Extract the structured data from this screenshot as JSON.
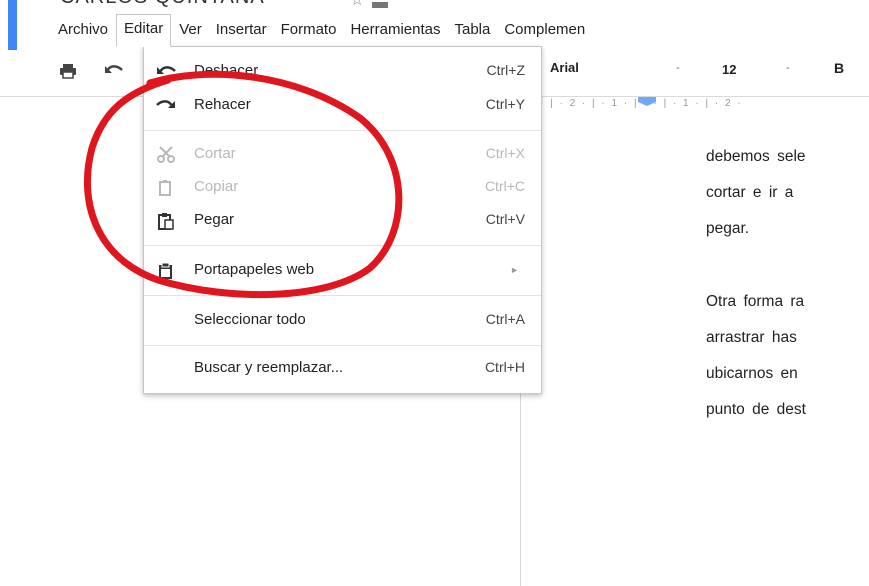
{
  "document": {
    "title": "CARLOS QUINTANA",
    "lines": [
      "debemos sele",
      "cortar e ir a",
      "pegar.",
      "Otra forma ra",
      "arrastrar has",
      "ubicarnos en",
      "punto de dest"
    ]
  },
  "menubar": {
    "items": [
      "Archivo",
      "Editar",
      "Ver",
      "Insertar",
      "Formato",
      "Herramientas",
      "Tabla",
      "Complemen"
    ]
  },
  "toolbar": {
    "font": "Arial",
    "size": "12",
    "bold": "B",
    "ruler_text": "· | · 2 · | · 1 · | ·    · | · 1 · | · 2 ·"
  },
  "edit_menu": {
    "items": [
      {
        "label": "Deshacer",
        "shortcut": "Ctrl+Z",
        "icon": "undo-icon",
        "enabled": true
      },
      {
        "label": "Rehacer",
        "shortcut": "Ctrl+Y",
        "icon": "redo-icon",
        "enabled": true
      },
      {
        "label": "Cortar",
        "shortcut": "Ctrl+X",
        "icon": "scissors-icon",
        "enabled": false
      },
      {
        "label": "Copiar",
        "shortcut": "Ctrl+C",
        "icon": "copy-icon",
        "enabled": false
      },
      {
        "label": "Pegar",
        "shortcut": "Ctrl+V",
        "icon": "paste-icon",
        "enabled": true
      },
      {
        "label": "Portapapeles web",
        "shortcut": "",
        "icon": "clipboard-icon",
        "enabled": true
      },
      {
        "label": "Seleccionar todo",
        "shortcut": "Ctrl+A",
        "icon": "",
        "enabled": true
      },
      {
        "label": "Buscar y reemplazar...",
        "shortcut": "Ctrl+H",
        "icon": "",
        "enabled": true
      }
    ]
  },
  "colors": {
    "accent_blue": "#4285f4",
    "annotation_red": "#e0161e"
  }
}
